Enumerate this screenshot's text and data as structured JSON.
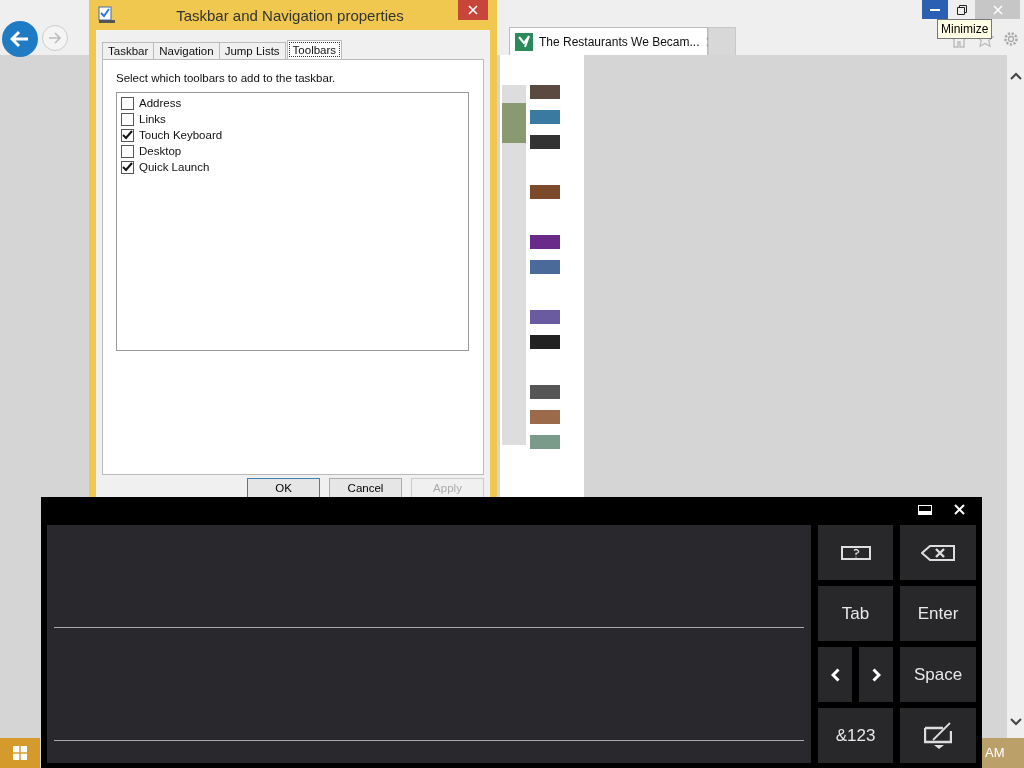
{
  "browser": {
    "tab": {
      "title": "The Restaurants We Becam..."
    },
    "tooltip": "Minimize"
  },
  "dialog": {
    "title": "Taskbar and Navigation properties",
    "tabs": [
      {
        "label": "Taskbar",
        "selected": false
      },
      {
        "label": "Navigation",
        "selected": false
      },
      {
        "label": "Jump Lists",
        "selected": false
      },
      {
        "label": "Toolbars",
        "selected": true
      }
    ],
    "instruction": "Select which toolbars to add to the taskbar.",
    "toolbars": [
      {
        "label": "Address",
        "checked": false
      },
      {
        "label": "Links",
        "checked": false
      },
      {
        "label": "Touch Keyboard",
        "checked": true
      },
      {
        "label": "Desktop",
        "checked": false
      },
      {
        "label": "Quick Launch",
        "checked": true
      }
    ],
    "buttons": [
      {
        "label": "OK",
        "default": true,
        "disabled": false
      },
      {
        "label": "Cancel",
        "default": false,
        "disabled": false
      },
      {
        "label": "Apply",
        "default": false,
        "disabled": true
      }
    ]
  },
  "keyboard": {
    "keys": [
      {
        "label": "Tab"
      },
      {
        "label": "Enter"
      },
      {
        "label": "Space"
      },
      {
        "label": "&123"
      }
    ]
  },
  "taskbar": {
    "clock": "AM"
  }
}
